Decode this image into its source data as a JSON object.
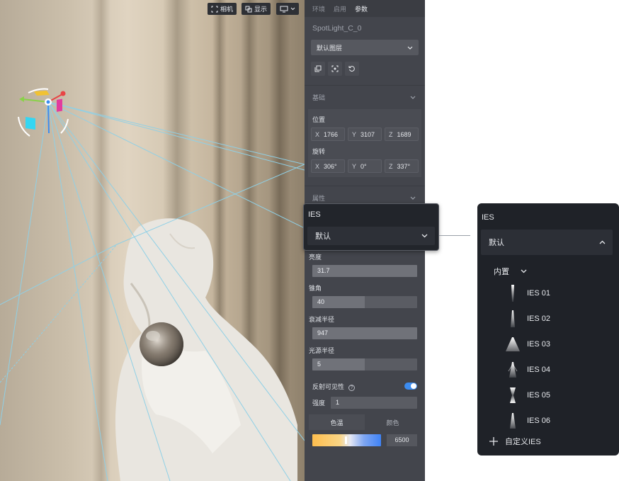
{
  "viewport": {
    "toolbar": {
      "camera_label": "相机",
      "display_label": "显示"
    }
  },
  "panel": {
    "tabs": [
      "环境",
      "启用",
      "参数"
    ],
    "active_tab": "参数",
    "object_name": "SpotLight_C_0",
    "layer_select": "默认图层",
    "basic_section": "基础",
    "position": {
      "label": "位置",
      "x": "1766",
      "y": "3107",
      "z": "1689"
    },
    "rotation": {
      "label": "旋转",
      "x": "306°",
      "y": "0°",
      "z": "337°"
    },
    "attributes_section": "属性",
    "brightness": {
      "label": "亮度",
      "value": "31.7",
      "fraction": 1.0
    },
    "cone_angle": {
      "label": "锥角",
      "value": "40",
      "fraction": 0.5
    },
    "attenuation_radius": {
      "label": "衰减半径",
      "value": "947",
      "fraction": 1.0
    },
    "source_radius": {
      "label": "光源半径",
      "value": "5",
      "fraction": 0.5
    },
    "reflection_visibility": {
      "label": "反射可见性",
      "enabled": true
    },
    "intensity": {
      "label": "强度",
      "value": "1"
    },
    "color_tabs": [
      "色温",
      "颜色"
    ],
    "color_temperature": {
      "value": "6500",
      "fraction": 0.48
    }
  },
  "ies_popup": {
    "title": "IES",
    "selected": "默认"
  },
  "ies_dropdown": {
    "title": "IES",
    "selected": "默认",
    "category": "内置",
    "items": [
      "IES 01",
      "IES 02",
      "IES 03",
      "IES 04",
      "IES 05",
      "IES 06"
    ],
    "custom_label": "自定义IES"
  },
  "colors": {
    "accent": "#3c8cf0",
    "panel_bg": "#43454c",
    "popup_bg": "#1f2228"
  }
}
